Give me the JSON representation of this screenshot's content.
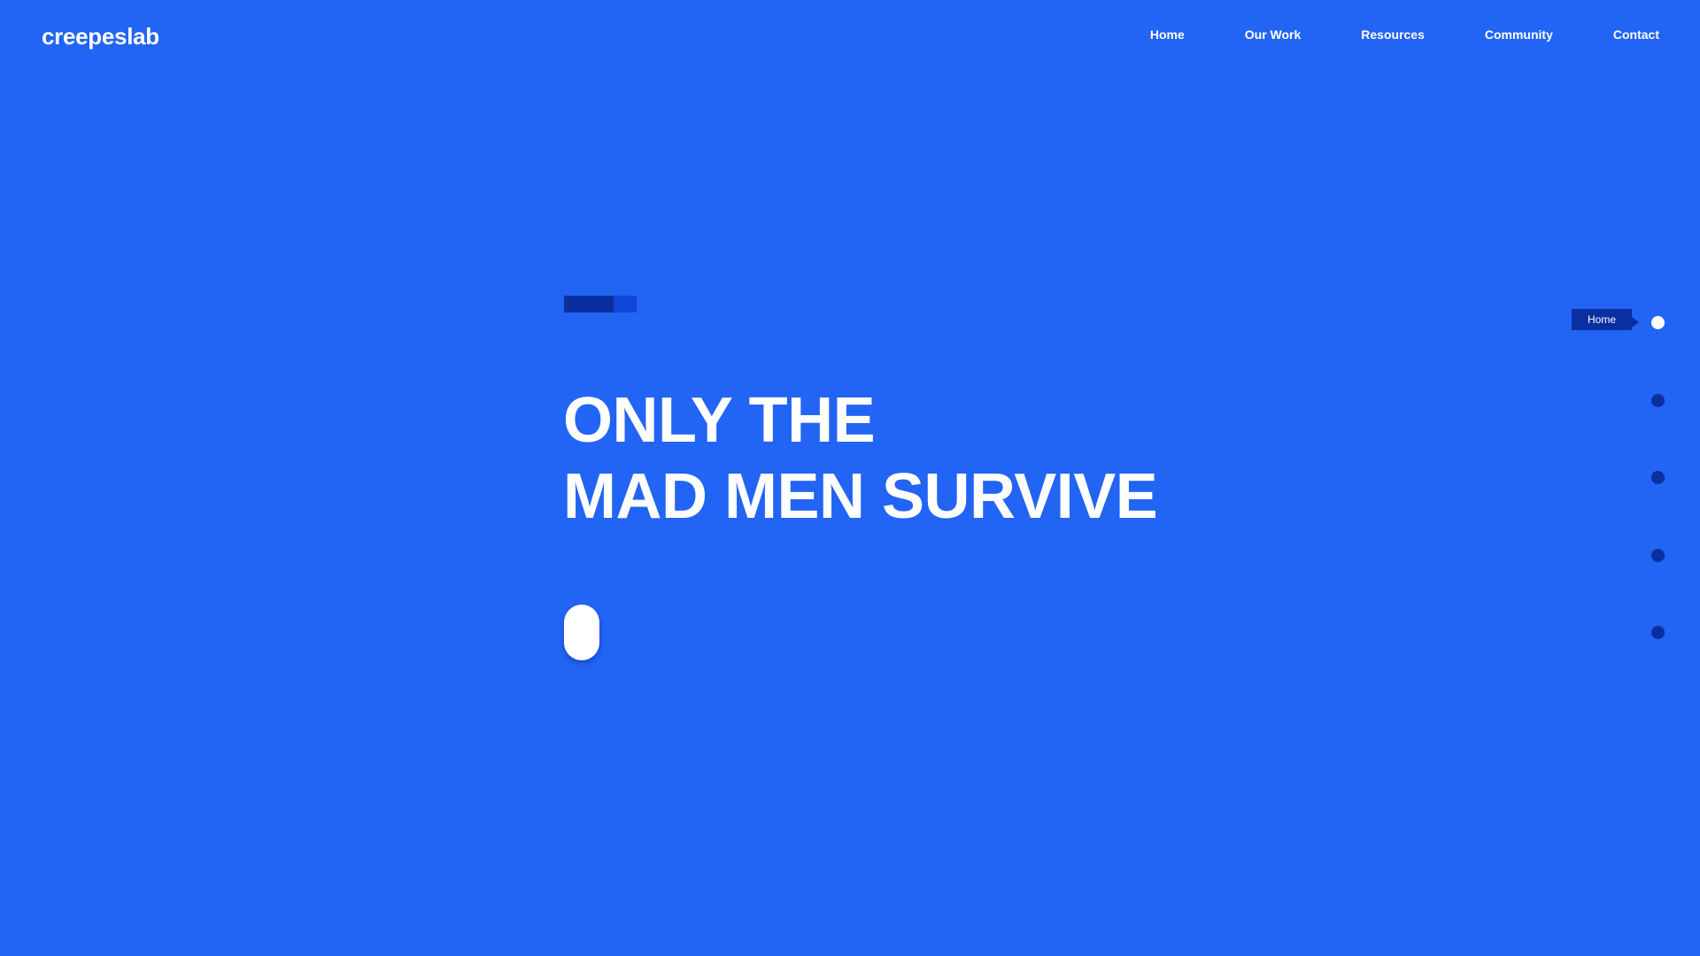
{
  "brand": {
    "logo_text": "creepeslab"
  },
  "nav": {
    "items": [
      {
        "label": "Home"
      },
      {
        "label": "Our Work"
      },
      {
        "label": "Resources"
      },
      {
        "label": "Community"
      },
      {
        "label": "Contact"
      }
    ]
  },
  "hero": {
    "headline_line1": "ONLY THE",
    "headline_line2": "MAD MEN SURVIVE"
  },
  "section_nav": {
    "active_label": "Home",
    "dot_count": 5,
    "active_index": 0
  },
  "colors": {
    "background": "#2264f3",
    "accent_dark": "#0a2fa0",
    "accent_mid": "#0e48d6",
    "text": "#ffffff"
  }
}
